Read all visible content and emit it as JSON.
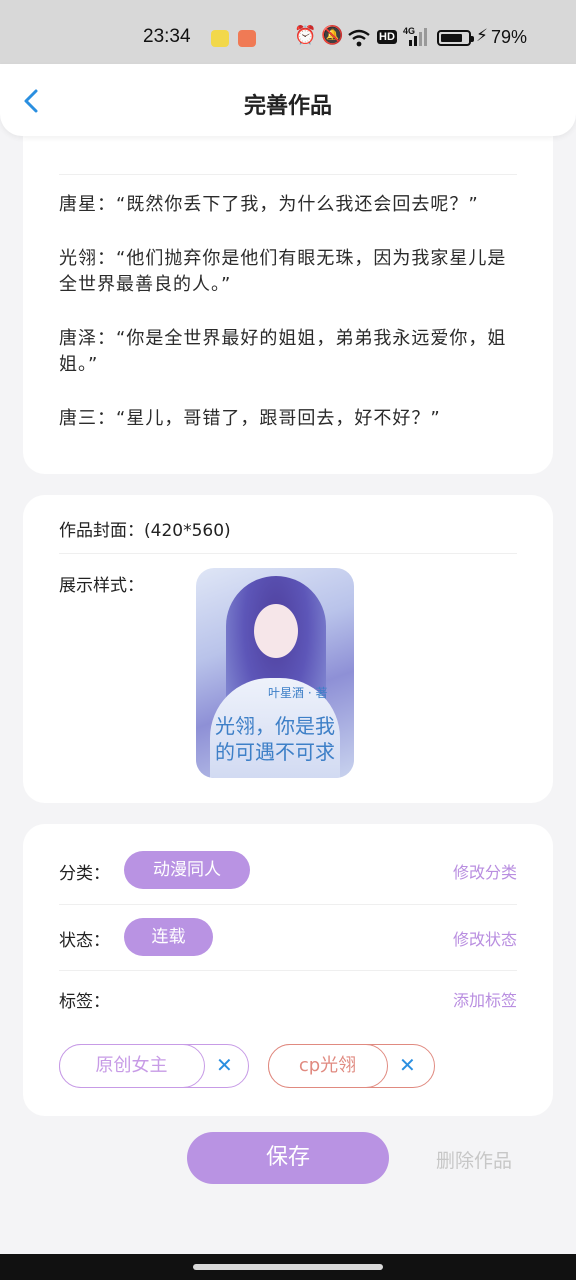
{
  "status_bar": {
    "time": "23:34",
    "battery": "79%",
    "battery_level": 0.79,
    "icons": [
      "app-icon-yellow",
      "app-icon-orange",
      "alarm-icon",
      "mute-icon",
      "wifi-icon",
      "hd-icon",
      "4g-signal-icon",
      "battery-icon",
      "charging-icon"
    ],
    "hd": "HD",
    "network": "4G"
  },
  "header": {
    "title": "完善作品",
    "back_icon": "chevron-left-icon"
  },
  "story": {
    "lines": [
      "唐星：“既然你丢下了我，为什么我还会回去呢？”",
      "光翎：“他们抛弃你是他们有眼无珠，因为我家星儿是全世界最善良的人。”",
      "唐泽：“你是全世界最好的姐姐，弟弟我永远爱你，姐姐。”",
      "唐三：“星儿，哥错了，跟哥回去，好不好？”"
    ]
  },
  "cover": {
    "label": "作品封面：(420*560)",
    "style_label": "展示样式：",
    "overlay_author": "叶星酒 · 著",
    "overlay_title_1": "光翎，你是我",
    "overlay_title_2": "的可遇不可求"
  },
  "meta": {
    "category_label": "分类：",
    "category_value": "动漫同人",
    "category_edit": "修改分类",
    "status_label": "状态：",
    "status_value": "连载",
    "status_edit": "修改状态",
    "tags_label": "标签：",
    "tags_add": "添加标签",
    "tags": [
      {
        "text": "原创女主",
        "color": "#c79be6"
      },
      {
        "text": "cp光翎",
        "color": "#e08a80"
      }
    ],
    "remove_icon": "close-icon"
  },
  "actions": {
    "save": "保存",
    "delete": "删除作品"
  },
  "colors": {
    "accent": "#b993e3",
    "link": "#b98ee0",
    "remove_x": "#2a8fe0",
    "back": "#2a8fe0"
  }
}
